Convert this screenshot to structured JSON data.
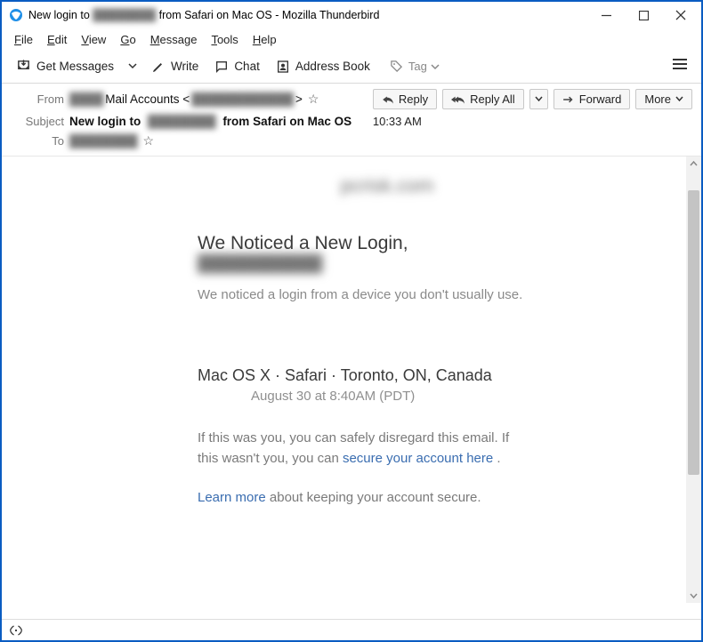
{
  "window": {
    "title_prefix": "New login to",
    "title_blur": "████████",
    "title_suffix": "from Safari on Mac OS - Mozilla Thunderbird"
  },
  "menubar": {
    "file": "File",
    "edit": "Edit",
    "view": "View",
    "go": "Go",
    "message": "Message",
    "tools": "Tools",
    "help": "Help"
  },
  "toolbar": {
    "get_messages": "Get Messages",
    "write": "Write",
    "chat": "Chat",
    "address_book": "Address Book",
    "tag": "Tag"
  },
  "header": {
    "from_label": "From",
    "from_blur1": "████",
    "from_text": "Mail Accounts <",
    "from_blur2": "████████████",
    "from_close": ">",
    "subject_label": "Subject",
    "subject_prefix": "New login to",
    "subject_blur": "████████",
    "subject_suffix": "from Safari on Mac OS",
    "to_label": "To",
    "to_blur": "████████",
    "time": "10:33 AM"
  },
  "actions": {
    "reply": "Reply",
    "reply_all": "Reply All",
    "forward": "Forward",
    "more": "More"
  },
  "mail": {
    "logo_blur": "pcrisk.com",
    "heading": "We Noticed a New Login,",
    "email_blur": "███████████",
    "lead": "We noticed a login from a device you don't usually use.",
    "device_line": "Mac OS X · Safari · Toronto, ON, Canada",
    "date_line": "August 30  at 8:40AM (PDT)",
    "para1_a": "If this was you, you can safely disregard this email. If this wasn't you, you can ",
    "secure_link": "secure your account here",
    "para1_b": " .",
    "learn_more": "Learn more",
    "para2_b": " about keeping your account secure."
  }
}
